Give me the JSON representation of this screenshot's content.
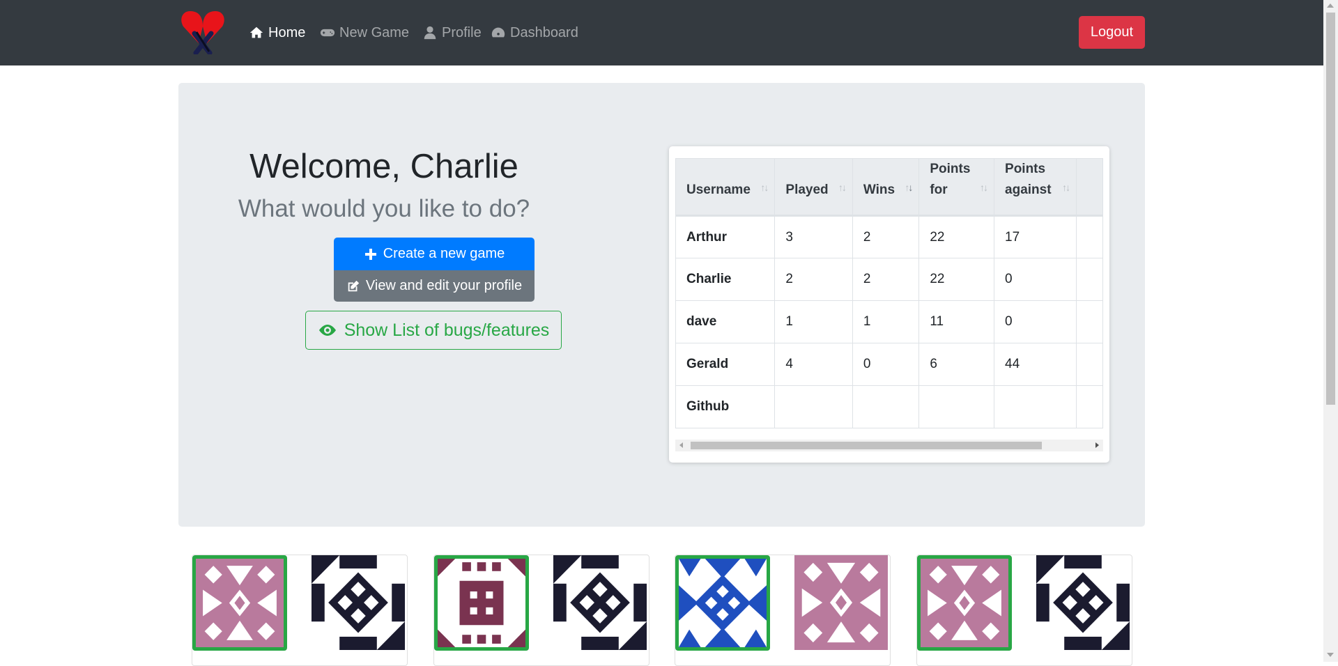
{
  "nav": {
    "items": [
      {
        "label": "Home",
        "icon": "home-icon",
        "active": true
      },
      {
        "label": "New Game",
        "icon": "gamepad-icon",
        "active": false
      },
      {
        "label": "Profile",
        "icon": "user-icon",
        "active": false
      },
      {
        "label": "Dashboard",
        "icon": "tachometer-icon",
        "active": false
      }
    ],
    "logout_label": "Logout"
  },
  "welcome": {
    "title": "Welcome, Charlie",
    "subtitle": "What would you like to do?"
  },
  "actions": {
    "create_label": "Create a new game",
    "profile_label": "View and edit your profile",
    "bugs_label": "Show List of bugs/features"
  },
  "leaderboard": {
    "headers": [
      "Username",
      "Played",
      "Wins",
      "Points\nfor",
      "Points\nagainst"
    ],
    "rows": [
      [
        "Arthur",
        "3",
        "2",
        "22",
        "17"
      ],
      [
        "Charlie",
        "2",
        "2",
        "22",
        "0"
      ],
      [
        "dave",
        "1",
        "1",
        "11",
        "0"
      ],
      [
        "Gerald",
        "4",
        "0",
        "6",
        "44"
      ],
      [
        "Github",
        "",
        "",
        "",
        ""
      ]
    ]
  },
  "colors": {
    "navbar": "#343a40",
    "primary": "#007bff",
    "secondary": "#6c757d",
    "success": "#28a745",
    "danger": "#dc3545",
    "avatar_pink": "#b97a9d",
    "avatar_navy": "#1b1b2f",
    "avatar_maroon": "#7a3350",
    "avatar_blue": "#1f4fbf"
  }
}
